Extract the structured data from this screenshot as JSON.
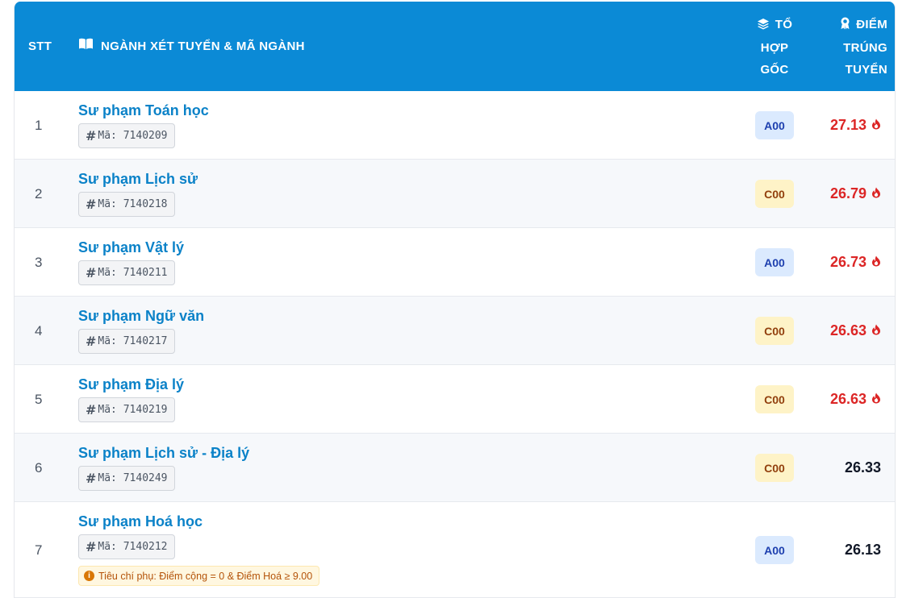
{
  "header": {
    "stt": "STT",
    "major": "NGÀNH XÉT TUYỂN & MÃ NGÀNH",
    "combo_lines": [
      "TỔ",
      "HỢP",
      "GỐC"
    ],
    "score_lines": [
      "ĐIỂM",
      "TRÚNG",
      "TUYỂN"
    ]
  },
  "rows": [
    {
      "stt": "1",
      "name": "Sư phạm Toán học",
      "code": "Mã: 7140209",
      "combo": "A00",
      "score": "27.13"
    },
    {
      "stt": "2",
      "name": "Sư phạm Lịch sử",
      "code": "Mã: 7140218",
      "combo": "C00",
      "score": "26.79"
    },
    {
      "stt": "3",
      "name": "Sư phạm Vật lý",
      "code": "Mã: 7140211",
      "combo": "A00",
      "score": "26.73"
    },
    {
      "stt": "4",
      "name": "Sư phạm Ngữ văn",
      "code": "Mã: 7140217",
      "combo": "C00",
      "score": "26.63"
    },
    {
      "stt": "5",
      "name": "Sư phạm Địa lý",
      "code": "Mã: 7140219",
      "combo": "C00",
      "score": "26.63"
    },
    {
      "stt": "6",
      "name": "Sư phạm Lịch sử - Địa lý",
      "code": "Mã: 7140249",
      "combo": "C00",
      "score": "26.33"
    },
    {
      "stt": "7",
      "name": "Sư phạm Hoá học",
      "code": "Mã: 7140212",
      "combo": "A00",
      "score": "26.13",
      "note": "Tiêu chí phụ: Điểm cộng = 0 & Điểm Hoá ≥ 9.00"
    }
  ],
  "icons": {
    "major_header": "book-open-icon",
    "combo_header": "layers-icon",
    "score_header": "award-icon",
    "hot_score": "fire-icon",
    "note": "info-icon"
  },
  "colors": {
    "header_bg": "#0b8ad6",
    "major_link": "#0b82c8",
    "hot_score": "#dc2626",
    "combo_a_bg": "#dbeafe",
    "combo_c_bg": "#fef3c7"
  }
}
